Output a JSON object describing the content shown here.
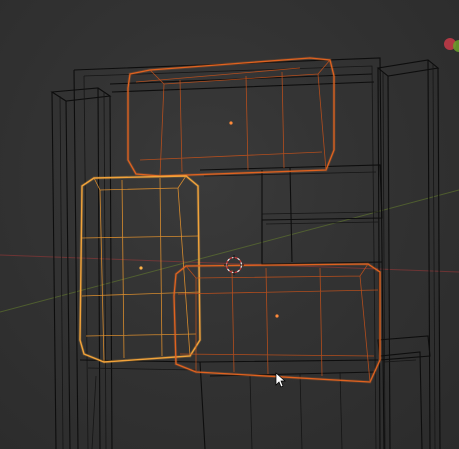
{
  "viewport": {
    "mode": "wireframe",
    "background_color": "#333333",
    "selected_outline_color": "#e0621f",
    "active_outline_color": "#f2a33a",
    "x_axis_color": "#a03838",
    "y_axis_color": "#6d8a2e"
  },
  "objects": {
    "selected_count": 3,
    "active": "left-tall-box",
    "selected": [
      "top-box",
      "left-tall-box",
      "bottom-right-box"
    ]
  },
  "icons": {
    "origin": "object-origin-dot",
    "cursor": "3d-cursor-icon",
    "pointer": "mouse-pointer-icon",
    "gizmo": "navigation-gizmo-icon"
  }
}
